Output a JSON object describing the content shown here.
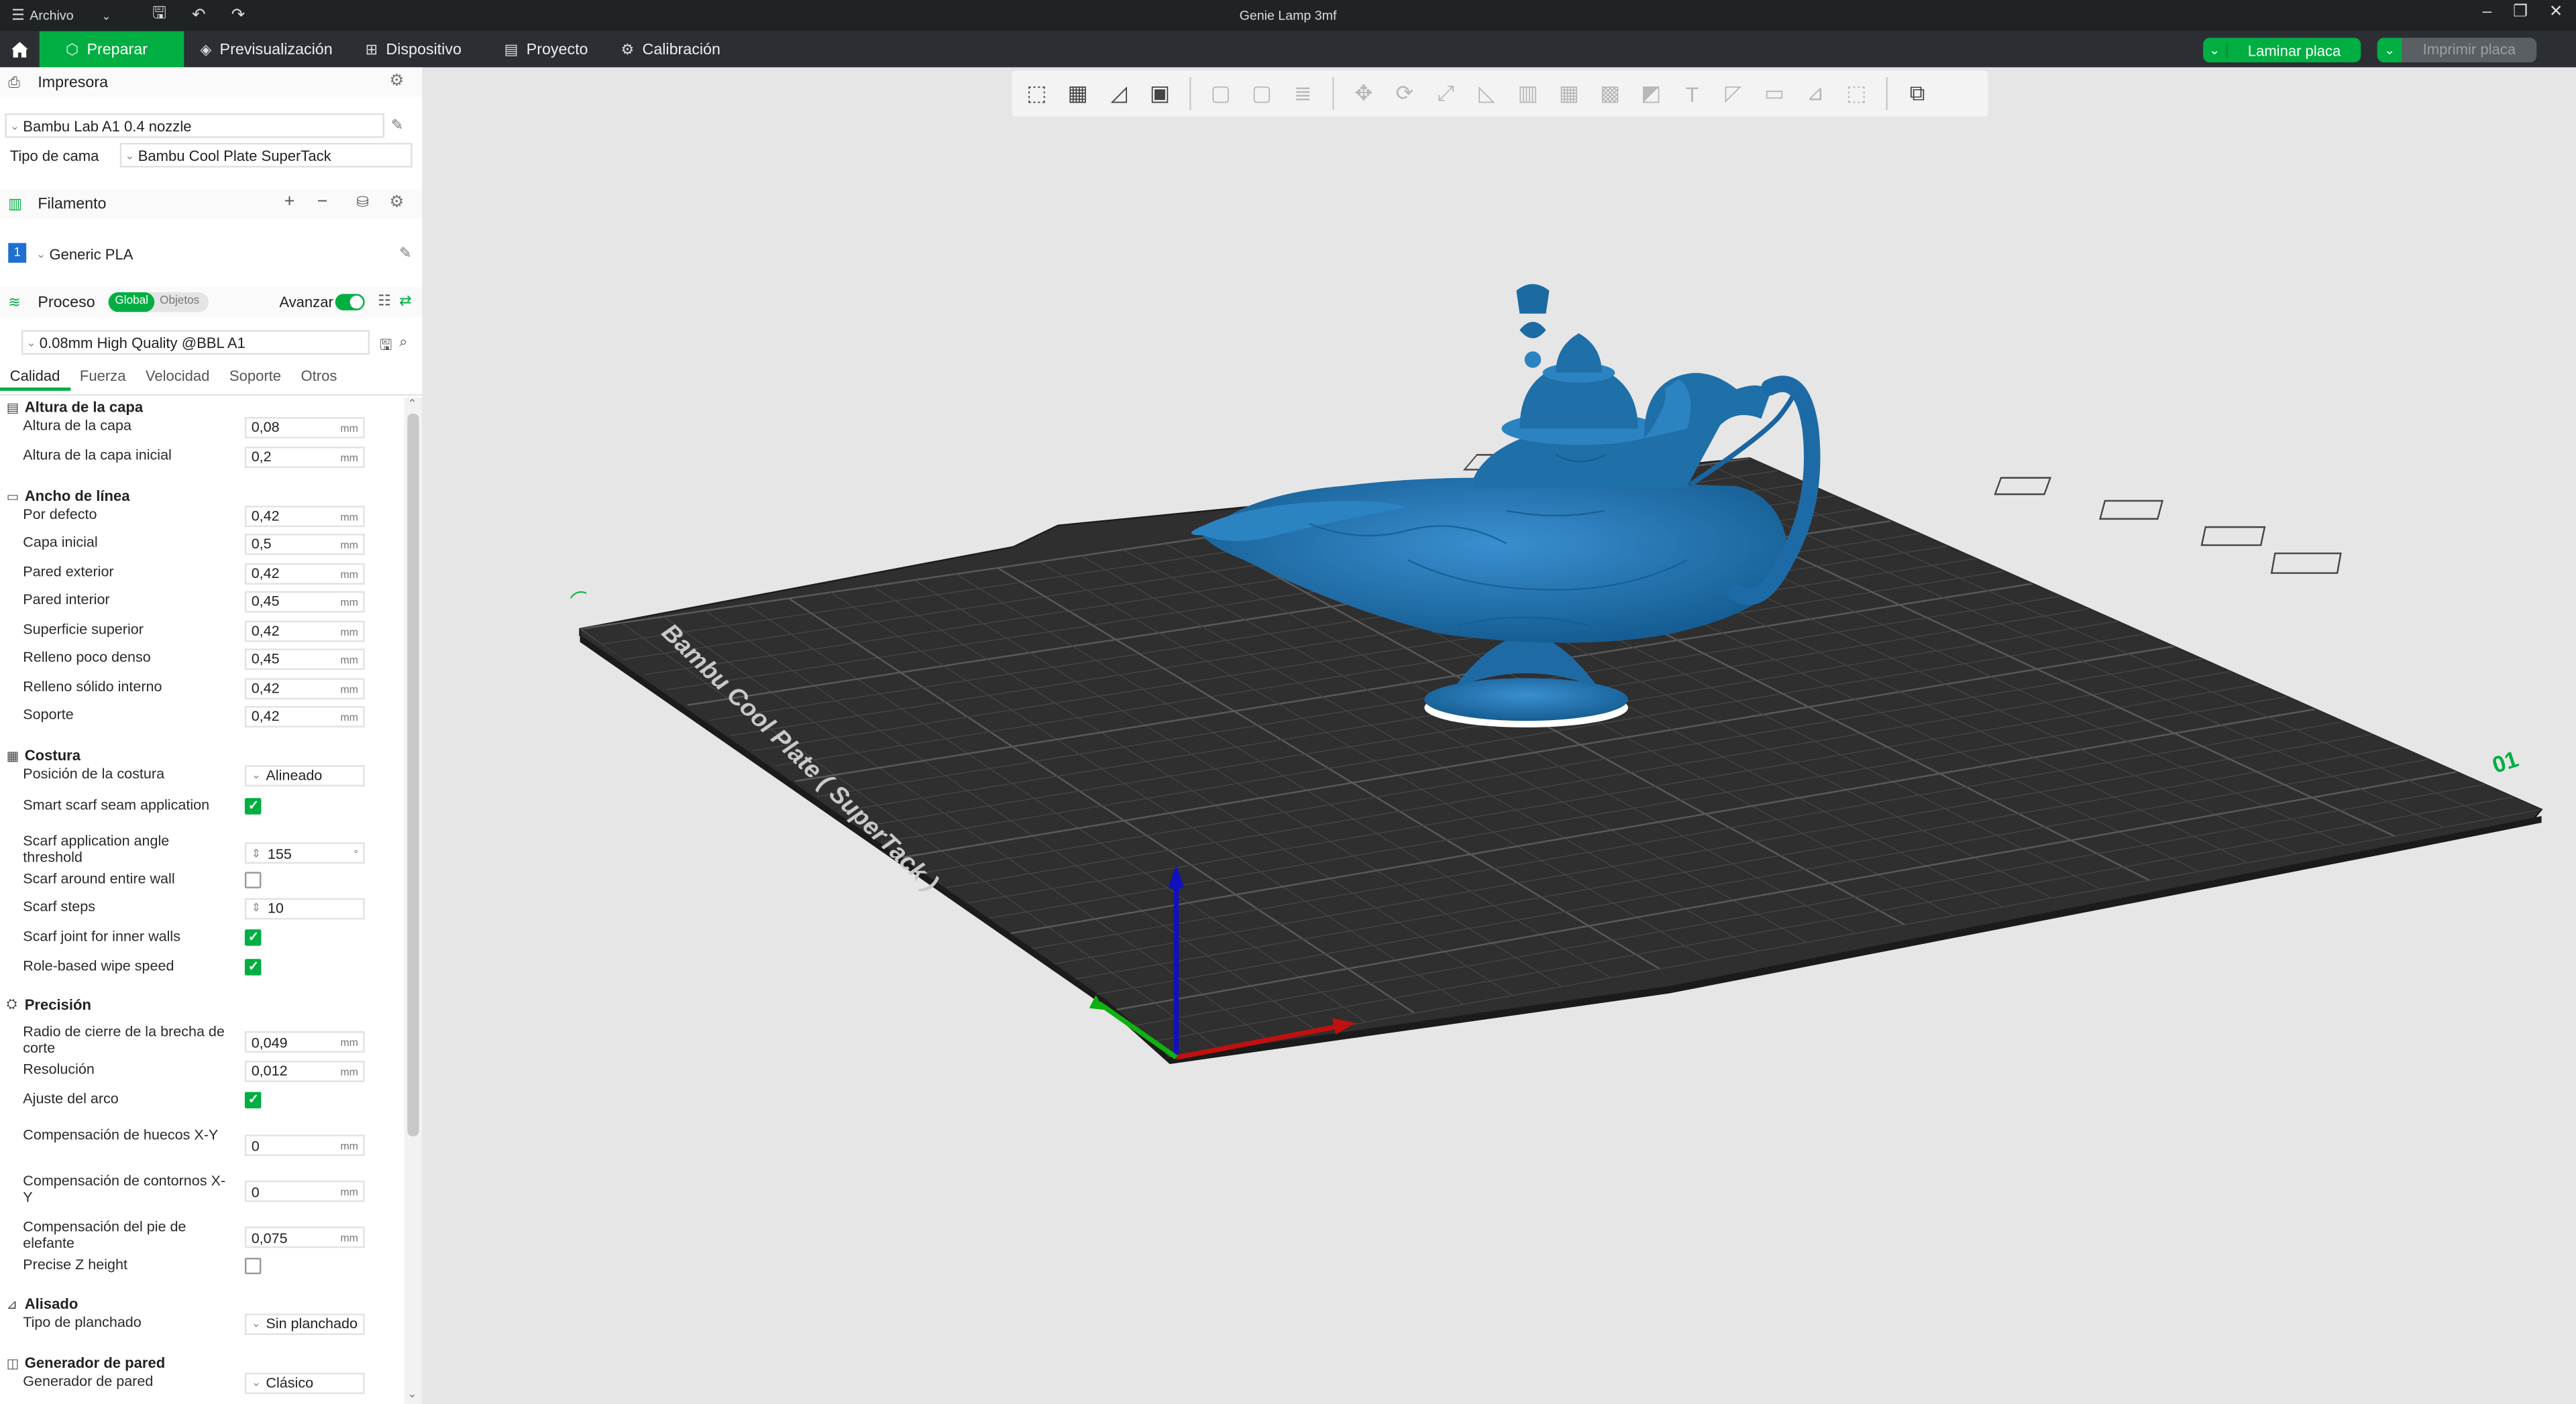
{
  "titlebar": {
    "menu_label": "Archivo",
    "title": "Genie Lamp 3mf"
  },
  "nav": {
    "tabs": [
      {
        "label": "Preparar"
      },
      {
        "label": "Previsualización"
      },
      {
        "label": "Dispositivo"
      },
      {
        "label": "Proyecto"
      },
      {
        "label": "Calibración"
      }
    ],
    "slice_label": "Laminar placa",
    "print_label": "Imprimir placa"
  },
  "printer": {
    "section_title": "Impresora",
    "preset": "Bambu Lab A1 0.4 nozzle",
    "bed_label": "Tipo de cama",
    "bed_value": "Bambu Cool Plate SuperTack"
  },
  "filament": {
    "section_title": "Filamento",
    "slot_number": "1",
    "preset": "Generic PLA",
    "slot_color": "#1e6fd0"
  },
  "process": {
    "section_title": "Proceso",
    "toggle_global": "Global",
    "toggle_objects": "Objetos",
    "advanced_label": "Avanzar",
    "preset": "0.08mm High Quality @BBL A1",
    "subtabs": [
      "Calidad",
      "Fuerza",
      "Velocidad",
      "Soporte",
      "Otros"
    ]
  },
  "settings": {
    "groups": [
      {
        "title": "Altura de la capa"
      },
      {
        "title": "Ancho de línea"
      },
      {
        "title": "Costura"
      },
      {
        "title": "Precisión"
      },
      {
        "title": "Alisado"
      },
      {
        "title": "Generador de pared"
      }
    ],
    "rows": [
      {
        "label": "Altura de la capa",
        "value": "0,08",
        "unit": "mm"
      },
      {
        "label": "Altura de la capa inicial",
        "value": "0,2",
        "unit": "mm"
      },
      {
        "label": "Por defecto",
        "value": "0,42",
        "unit": "mm"
      },
      {
        "label": "Capa inicial",
        "value": "0,5",
        "unit": "mm"
      },
      {
        "label": "Pared exterior",
        "value": "0,42",
        "unit": "mm"
      },
      {
        "label": "Pared interior",
        "value": "0,45",
        "unit": "mm"
      },
      {
        "label": "Superficie superior",
        "value": "0,42",
        "unit": "mm"
      },
      {
        "label": "Relleno poco denso",
        "value": "0,45",
        "unit": "mm"
      },
      {
        "label": "Relleno sólido interno",
        "value": "0,42",
        "unit": "mm"
      },
      {
        "label": "Soporte",
        "value": "0,42",
        "unit": "mm"
      },
      {
        "label": "Posición de la costura",
        "value": "Alineado"
      },
      {
        "label": "Smart scarf seam application",
        "checked": true
      },
      {
        "label": "Scarf application angle threshold",
        "value": "155",
        "unit": "°"
      },
      {
        "label": "Scarf around entire wall",
        "checked": false
      },
      {
        "label": "Scarf steps",
        "value": "10"
      },
      {
        "label": "Scarf joint for inner walls",
        "checked": true
      },
      {
        "label": "Role-based wipe speed",
        "checked": true
      },
      {
        "label": "Radio de cierre de la brecha de corte",
        "value": "0,049",
        "unit": "mm"
      },
      {
        "label": "Resolución",
        "value": "0,012",
        "unit": "mm"
      },
      {
        "label": "Ajuste del arco",
        "checked": true
      },
      {
        "label": "Compensación de huecos X-Y",
        "value": "0",
        "unit": "mm"
      },
      {
        "label": "Compensación de contornos X-Y",
        "value": "0",
        "unit": "mm"
      },
      {
        "label": "Compensación del pie de elefante",
        "value": "0,075",
        "unit": "mm"
      },
      {
        "label": "Precise Z height",
        "checked": false
      },
      {
        "label": "Tipo de planchado",
        "value": "Sin planchado"
      },
      {
        "label": "Generador de pared",
        "value": "Clásico"
      }
    ]
  },
  "viewport": {
    "plate_name": "Bambu Cool Plate ( SuperTack )",
    "plate_number": "01",
    "model_color": "#1f6fa8",
    "accent": "#00ae42"
  },
  "toolbar_icons": [
    "add-object-icon",
    "grid-arrange-icon",
    "orient-icon",
    "plate-icon",
    "clone-icon",
    "part-icon",
    "layers-icon",
    "move-icon",
    "rotate-icon",
    "scale-icon",
    "lay-flat-icon",
    "cut-icon",
    "boolean-icon",
    "support-paint-icon",
    "seam-paint-icon",
    "text-icon",
    "color-paint-icon",
    "measure-icon",
    "assembly-icon",
    "variable-layer-icon",
    "explode-icon"
  ]
}
